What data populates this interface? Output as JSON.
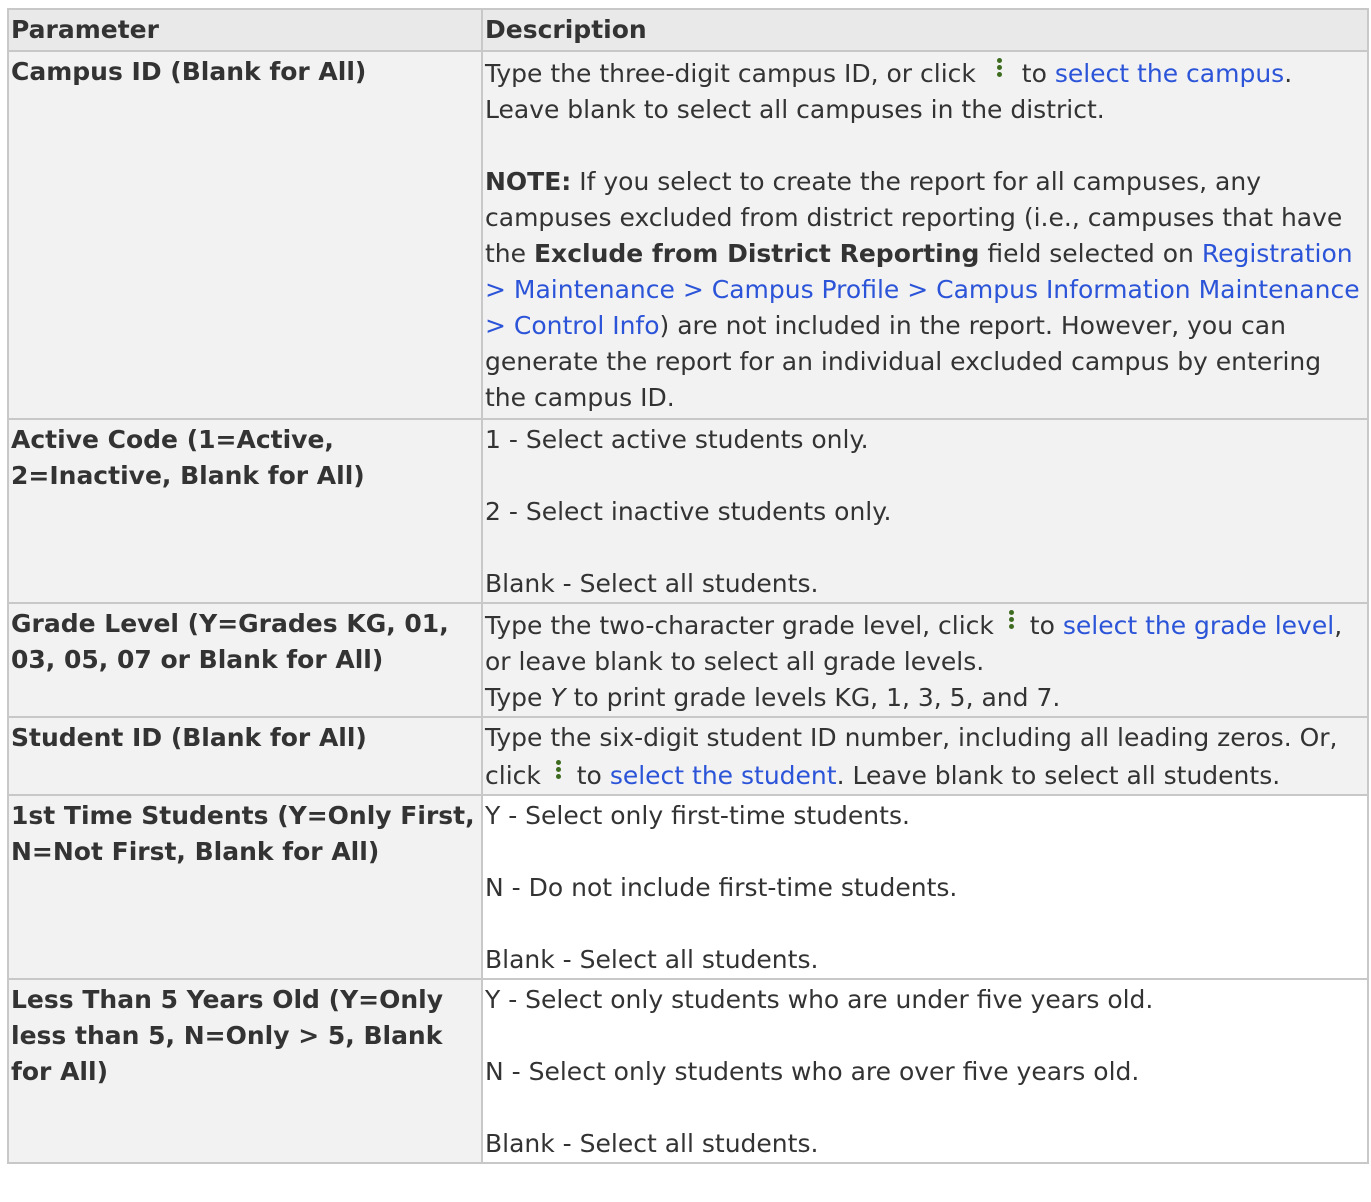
{
  "headers": {
    "parameter": "Parameter",
    "description": "Description"
  },
  "icons": {
    "lookup": "vertical-ellipsis-icon"
  },
  "colors": {
    "link": "#2b54d8",
    "icon": "#3d6b1f",
    "border": "#c8c8c8",
    "shade": "#f2f2f2"
  },
  "rows": [
    {
      "param": "Campus ID (Blank for All)",
      "p1_a": "Type the three-digit campus ID, or click ",
      "p1_b": " to ",
      "p1_link": "select the campus",
      "p1_c": ". Leave blank to select all campuses in the district.",
      "note_label": "NOTE:",
      "note_a": " If you select to create the report for all campuses, any campuses excluded from district reporting (i.e., campuses that have the ",
      "note_bold": "Exclude from District Reporting",
      "note_b": " field selected on ",
      "note_link": "Registration > Maintenance > Campus Profile > Campus Information Maintenance > Control Info",
      "note_c": ") are not included in the report. However, you can generate the report for an individual excluded campus by entering the campus ID."
    },
    {
      "param": "Active Code (1=Active, 2=Inactive, Blank for All)",
      "line1": "1 - Select active students only.",
      "line2": "2 - Select inactive students only.",
      "line3": "Blank - Select all students."
    },
    {
      "param": "Grade Level (Y=Grades KG, 01, 03, 05, 07 or Blank for All)",
      "p1_a": "Type the two-character grade level, click ",
      "p1_b": " to ",
      "p1_link": "select the grade level",
      "p1_c": ", or leave blank to select all grade levels.",
      "p2_a": "Type ",
      "p2_em": "Y",
      "p2_b": " to print grade levels KG, 1, 3, 5, and 7."
    },
    {
      "param": "Student ID (Blank for All)",
      "p1_a": "Type the six-digit student ID number, including all leading zeros. Or, click ",
      "p1_b": " to ",
      "p1_link": "select the student",
      "p1_c": ". Leave blank to select all students."
    },
    {
      "param": "1st Time Students (Y=Only First, N=Not First, Blank for All)",
      "line1": "Y - Select only first-time students.",
      "line2": "N - Do not include first-time students.",
      "line3": "Blank - Select all students."
    },
    {
      "param": "Less Than 5 Years Old (Y=Only less than 5, N=Only > 5, Blank for All)",
      "line1": "Y - Select only students who are under five years old.",
      "line2": "N - Select only students who are over five years old.",
      "line3": "Blank - Select all students."
    }
  ]
}
